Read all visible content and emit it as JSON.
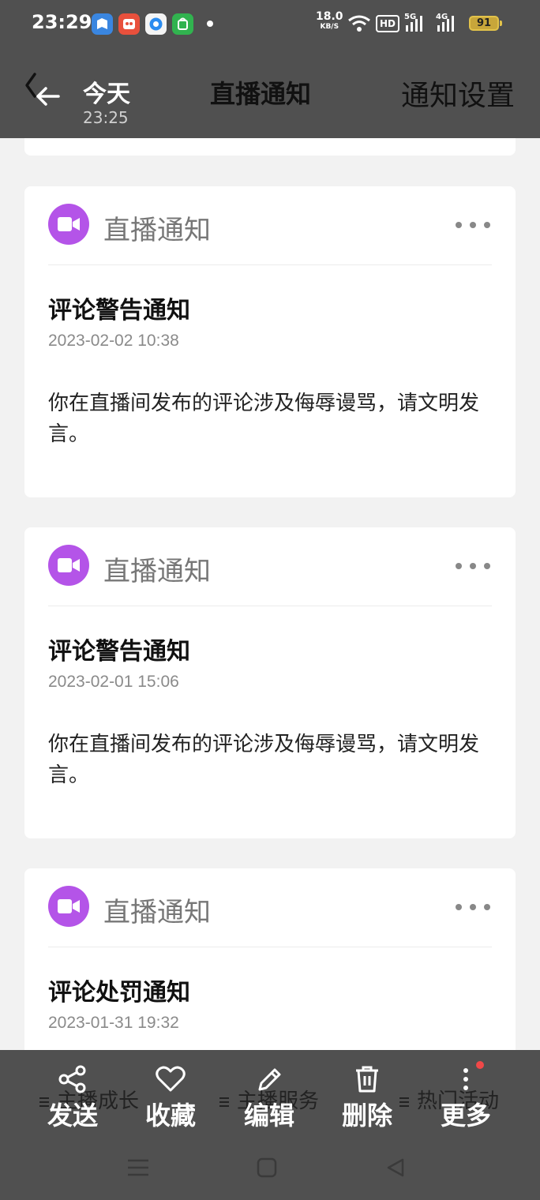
{
  "status_bar": {
    "time": "23:29",
    "net_speed_value": "18.0",
    "net_speed_unit": "KB/S",
    "hd_label": "HD",
    "signal_1_label": "5G",
    "signal_2_label": "4G",
    "battery": "91",
    "app_icons": [
      "map-app-icon",
      "video-app-icon",
      "browser-app-icon",
      "store-app-icon"
    ]
  },
  "header": {
    "date": "今天",
    "time": "23:25",
    "title": "直播通知",
    "settings_label": "通知设置"
  },
  "notifications": [
    {
      "source": "直播通知",
      "title": "评论警告通知",
      "date": "2023-02-02 10:38",
      "body": "你在直播间发布的评论涉及侮辱谩骂，请文明发言。"
    },
    {
      "source": "直播通知",
      "title": "评论警告通知",
      "date": "2023-02-01 15:06",
      "body": "你在直播间发布的评论涉及侮辱谩骂，请文明发言。"
    },
    {
      "source": "直播通知",
      "title": "评论处罚通知",
      "date": "2023-01-31 19:32"
    }
  ],
  "underlying_menu": [
    "主播成长",
    "主播服务",
    "热门活动"
  ],
  "actions": [
    "发送",
    "收藏",
    "编辑",
    "删除",
    "更多"
  ],
  "colors": {
    "avatar": "#b454e8",
    "overlay": "#505050",
    "badge": "#f04848"
  }
}
